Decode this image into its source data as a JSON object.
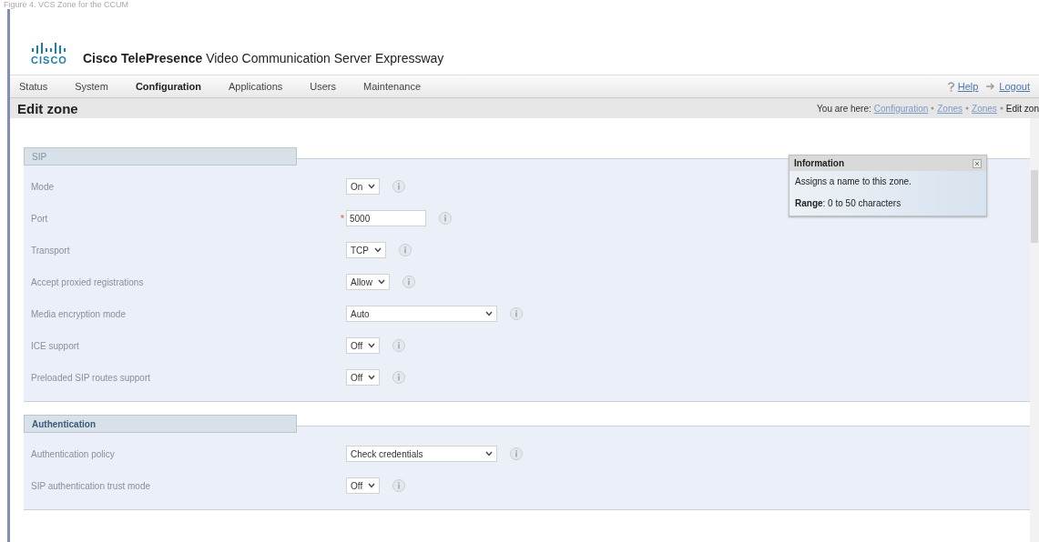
{
  "caption": "Figure 4. VCS Zone for the CCUM",
  "header": {
    "logo_text": "CISCO",
    "product_bold": "Cisco TelePresence",
    "product_rest": "Video Communication Server Expressway"
  },
  "nav": {
    "items": [
      {
        "label": "Status",
        "selected": false
      },
      {
        "label": "System",
        "selected": false
      },
      {
        "label": "Configuration",
        "selected": true
      },
      {
        "label": "Applications",
        "selected": false
      },
      {
        "label": "Users",
        "selected": false
      },
      {
        "label": "Maintenance",
        "selected": false
      }
    ],
    "help": "Help",
    "logout": "Logout"
  },
  "page_title": "Edit zone",
  "breadcrumb": {
    "prefix": "You are here:",
    "links": [
      "Configuration",
      "Zones",
      "Zones"
    ],
    "current": "Edit zon"
  },
  "sections": [
    {
      "title": "SIP",
      "fields": [
        {
          "label": "Mode",
          "kind": "dropdown",
          "value": "On"
        },
        {
          "label": "Port",
          "kind": "textbox",
          "value": "5000",
          "marker": "*"
        },
        {
          "label": "Transport",
          "kind": "dropdown",
          "value": "TCP"
        },
        {
          "label": "Accept proxied registrations",
          "kind": "dropdown",
          "value": "Allow"
        },
        {
          "label": "Media encryption mode",
          "kind": "longdropdown",
          "value": "Auto"
        },
        {
          "label": "ICE support",
          "kind": "dropdown",
          "value": "Off"
        },
        {
          "label": "Preloaded SIP routes support",
          "kind": "dropdown",
          "value": "Off"
        }
      ]
    },
    {
      "title": "Authentication",
      "fields": [
        {
          "label": "Authentication policy",
          "kind": "longdropdown",
          "value": "Check credentials"
        },
        {
          "label": "SIP authentication trust mode",
          "kind": "dropdown",
          "value": "Off"
        }
      ]
    }
  ],
  "info": {
    "title": "Information",
    "text": "Assigns a name to this zone.",
    "range_label": "Range",
    "range_text": ": 0 to 50 characters"
  }
}
